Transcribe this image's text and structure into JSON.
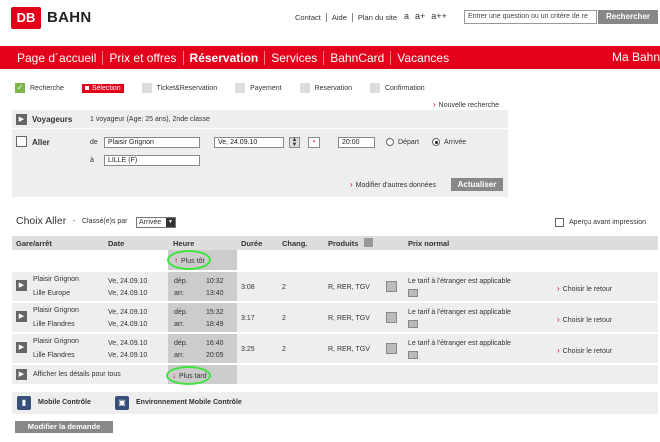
{
  "header": {
    "logo": "DB",
    "brand": "BAHN",
    "links": [
      "Contact",
      "Aide",
      "Plan du site"
    ],
    "font_sizes": [
      "a",
      "a+",
      "a++"
    ],
    "search_placeholder": "Entrer une question ou un critère de re",
    "search_button": "Rechercher"
  },
  "nav": {
    "items": [
      "Page d´accueil",
      "Prix et offres",
      "Réservation",
      "Services",
      "BahnCard",
      "Vacances"
    ],
    "right": "Ma Bahn",
    "active": "Réservation"
  },
  "steps": [
    "Recherche",
    "Sélection",
    "Ticket&Reservation",
    "Payement",
    "Reservation",
    "Confirmation"
  ],
  "new_search": "Nouvelle recherche",
  "voyageurs": {
    "label": "Voyageurs",
    "value": "1 voyageur (Age: 25 ans), 2nde classe"
  },
  "aller": {
    "label": "Aller",
    "de_label": "de",
    "de_value": "Plaisir Grignon",
    "a_label": "à",
    "a_value": "LILLE (F)",
    "date": "Ve, 24.09.10",
    "time": "20:00",
    "depart": "Départ",
    "arrivee": "Arrivée",
    "modify_link": "Modifier d'autres données",
    "update_button": "Actualiser"
  },
  "results": {
    "title": "Choix Aller",
    "dash": "-",
    "classe_label": "Classé(e)s par",
    "sort_value": "Arrivée",
    "apercu": "Aperçu avant impression",
    "columns": [
      "Gare/arrêt",
      "Date",
      "Heure",
      "Durée",
      "Chang.",
      "Produits",
      "Prix normal"
    ],
    "plus_tot": "Plus tôt",
    "plus_tard": "Plus tard",
    "details": "Afficher les détails pour tous",
    "rows": [
      {
        "from": "Plaisir Grignon",
        "to": "Lille Europe",
        "date1": "Ve, 24.09.10",
        "date2": "Ve, 24.09.10",
        "dep": "dép.",
        "arr": "arr.",
        "t1": "10:32",
        "t2": "13:40",
        "duree": "3:08",
        "chang": "2",
        "produits": "R, RER, TGV",
        "prix": "Le tarif à l'étranger est applicable",
        "action": "Choisir le retour"
      },
      {
        "from": "Plaisir Grignon",
        "to": "Lille Flandres",
        "date1": "Ve, 24.09.10",
        "date2": "Ve, 24.09.10",
        "dep": "dép.",
        "arr": "arr.",
        "t1": "15:32",
        "t2": "18:49",
        "duree": "3:17",
        "chang": "2",
        "produits": "R, RER, TGV",
        "prix": "Le tarif à l'étranger est applicable",
        "action": "Choisir le retour"
      },
      {
        "from": "Plaisir Grignon",
        "to": "Lille Flandres",
        "date1": "Ve, 24.09.10",
        "date2": "Ve, 24.09.10",
        "dep": "dép.",
        "arr": "arr.",
        "t1": "16:40",
        "t2": "20:05",
        "duree": "3:25",
        "chang": "2",
        "produits": "R, RER, TGV",
        "prix": "Le tarif à l'étranger est applicable",
        "action": "Choisir le retour"
      }
    ]
  },
  "mobile": [
    "Mobile Contrôle",
    "Environnement Mobile Contrôle"
  ],
  "modify_button": "Modifier la demande",
  "colors": {
    "brand_red": "#e3001b",
    "annotation_green": "#3fe23f"
  }
}
